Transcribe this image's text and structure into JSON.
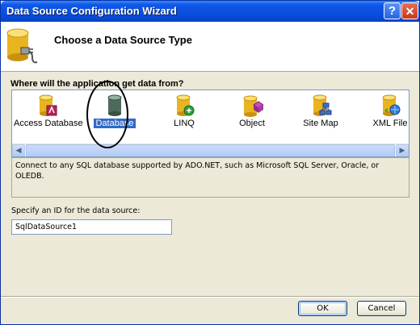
{
  "window": {
    "title": "Data Source Configuration Wizard",
    "help_glyph": "?",
    "close_glyph": "✕"
  },
  "header": {
    "title": "Choose a Data Source Type",
    "icon": "database-plug-icon"
  },
  "source_picker": {
    "question": "Where will the application get data from?",
    "selected": "Database",
    "types": [
      {
        "label": "Access Database",
        "icon": "access-database-icon"
      },
      {
        "label": "Database",
        "icon": "database-icon"
      },
      {
        "label": "LINQ",
        "icon": "linq-icon"
      },
      {
        "label": "Object",
        "icon": "object-icon"
      },
      {
        "label": "Site Map",
        "icon": "site-map-icon"
      },
      {
        "label": "XML File",
        "icon": "xml-file-icon"
      }
    ],
    "scroll_left_glyph": "◀",
    "scroll_right_glyph": "▶"
  },
  "description": "Connect to any SQL database supported by ADO.NET, such as Microsoft SQL Server, Oracle, or OLEDB.",
  "id_field": {
    "label": "Specify an ID for the data source:",
    "value": "SqlDataSource1"
  },
  "buttons": {
    "ok": "OK",
    "cancel": "Cancel"
  },
  "colors": {
    "titlebar": "#0a4fe0",
    "dialog_bg": "#ece9d8",
    "selection": "#316ac5"
  }
}
